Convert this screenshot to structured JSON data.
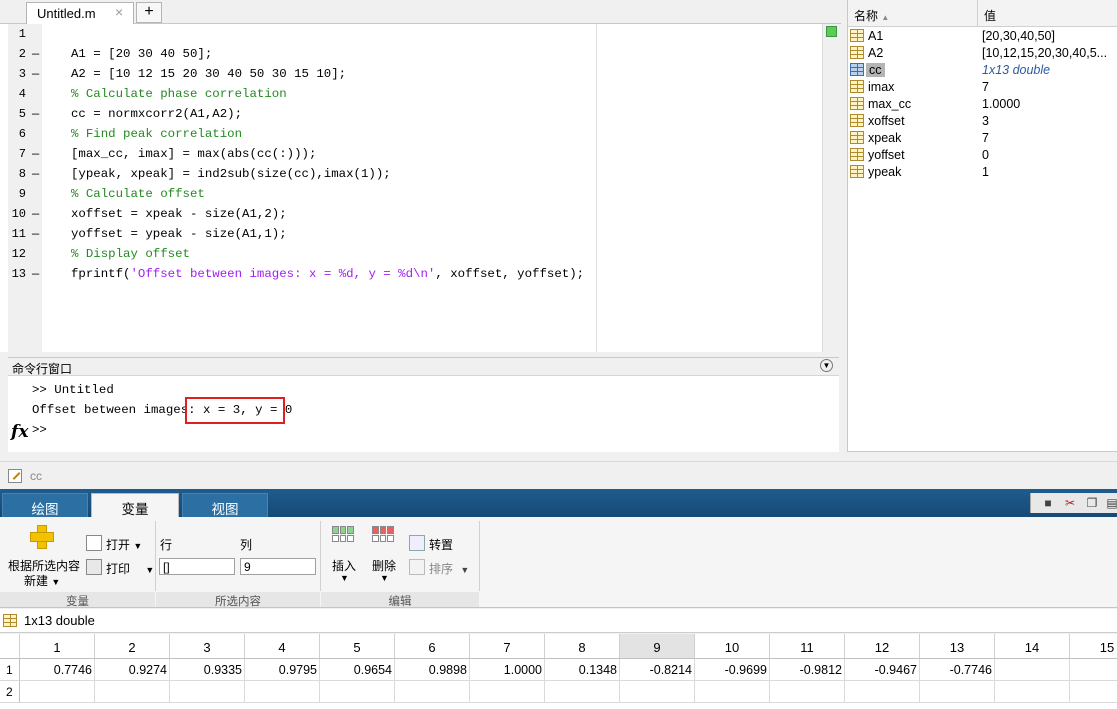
{
  "editor": {
    "tab_label": "Untitled.m",
    "tab_close": "×",
    "tab_add": "+",
    "lines": [
      {
        "n": "1",
        "dash": "",
        "text": "",
        "type": "code"
      },
      {
        "n": "2",
        "dash": "—",
        "text": "A1 = [20 30 40 50];",
        "type": "code"
      },
      {
        "n": "3",
        "dash": "—",
        "text": "A2 = [10 12 15 20 30 40 50 30 15 10];",
        "type": "code"
      },
      {
        "n": "4",
        "dash": "",
        "text": "% Calculate phase correlation",
        "type": "comment"
      },
      {
        "n": "5",
        "dash": "—",
        "text": "cc = normxcorr2(A1,A2);",
        "type": "code"
      },
      {
        "n": "6",
        "dash": "",
        "text": "% Find peak correlation",
        "type": "comment"
      },
      {
        "n": "7",
        "dash": "—",
        "text": "[max_cc, imax] = max(abs(cc(:)));",
        "type": "code"
      },
      {
        "n": "8",
        "dash": "—",
        "text": "[ypeak, xpeak] = ind2sub(size(cc),imax(1));",
        "type": "code"
      },
      {
        "n": "9",
        "dash": "",
        "text": "% Calculate offset",
        "type": "comment"
      },
      {
        "n": "10",
        "dash": "—",
        "text": "xoffset = xpeak - size(A1,2);",
        "type": "code"
      },
      {
        "n": "11",
        "dash": "—",
        "text": "yoffset = ypeak - size(A1,1);",
        "type": "code"
      },
      {
        "n": "12",
        "dash": "",
        "text": "% Display offset",
        "type": "comment"
      },
      {
        "n": "13",
        "dash": "—",
        "text_pre": "fprintf(",
        "text_str": "'Offset between images: x = %d, y = %d\\n'",
        "text_post": ", xoffset, yoffset);",
        "type": "mixed"
      }
    ]
  },
  "command_window": {
    "title": "命令行窗口",
    "line1": ">> Untitled",
    "line2_prefix": "Offset between images:",
    "line2_result": " x = 3, y = 0",
    "prompt": ">>",
    "fx": "fx"
  },
  "workspace": {
    "col_name": "名称",
    "sort_indicator": "▲",
    "col_value": "值",
    "vars": [
      {
        "name": "A1",
        "value": "[20,30,40,50]",
        "selected": false
      },
      {
        "name": "A2",
        "value": "[10,12,15,20,30,40,5...",
        "selected": false
      },
      {
        "name": "cc",
        "value": "1x13 double",
        "selected": true
      },
      {
        "name": "imax",
        "value": "7",
        "selected": false
      },
      {
        "name": "max_cc",
        "value": "1.0000",
        "selected": false
      },
      {
        "name": "xoffset",
        "value": "3",
        "selected": false
      },
      {
        "name": "xpeak",
        "value": "7",
        "selected": false
      },
      {
        "name": "yoffset",
        "value": "0",
        "selected": false
      },
      {
        "name": "ypeak",
        "value": "1",
        "selected": false
      }
    ]
  },
  "variable_editor": {
    "doc_title": "cc",
    "tabs": [
      "绘图",
      "变量",
      "视图"
    ],
    "active_tab": "变量",
    "new_from_selection": "根据所选内容",
    "new_label": "新建",
    "open_label": "打开",
    "print_label": "打印",
    "group_variable": "变量",
    "row_label": "行",
    "col_label": "列",
    "row_value": "[]",
    "col_value": "9",
    "group_selection": "所选内容",
    "insert_label": "插入",
    "delete_label": "删除",
    "transpose_label": "转置",
    "sort_label": "排序",
    "group_edit": "编辑",
    "info": "1x13 double",
    "col_headers": [
      "1",
      "2",
      "3",
      "4",
      "5",
      "6",
      "7",
      "8",
      "9",
      "10",
      "11",
      "12",
      "13",
      "14",
      "15"
    ],
    "selected_col": "9",
    "row_headers": [
      "1",
      "2"
    ],
    "row1": [
      "0.7746",
      "0.9274",
      "0.9335",
      "0.9795",
      "0.9654",
      "0.9898",
      "1.0000",
      "0.1348",
      "-0.8214",
      "-0.9699",
      "-0.9812",
      "-0.9467",
      "-0.7746",
      "",
      ""
    ]
  }
}
